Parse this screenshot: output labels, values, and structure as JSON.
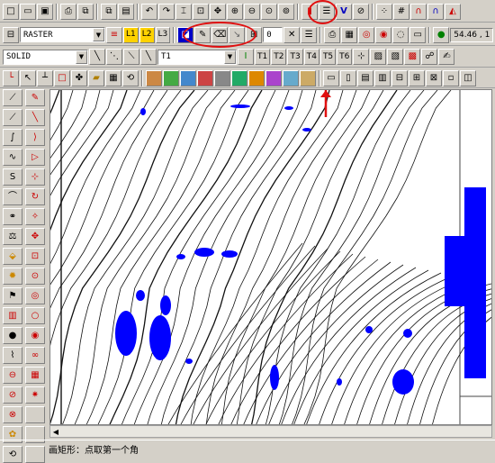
{
  "toolbar1": {
    "zoom_icons": [
      "zoom-in-icon",
      "zoom-out-icon",
      "zoom-fit-icon",
      "zoom-window-icon"
    ],
    "v_label": "V"
  },
  "toolbar2": {
    "raster_value": "RASTER",
    "layer_buttons": [
      "L1",
      "L2",
      "L3"
    ],
    "pencil_icon": "pencil-icon",
    "eraser_icon": "eraser-icon",
    "num_field": "0",
    "coordinate": "54.46 , 1"
  },
  "toolbar3": {
    "line_style": "SOLID",
    "text_style": "T1",
    "text_buttons": [
      "T1",
      "T2",
      "T3",
      "T4",
      "T5",
      "T6"
    ]
  },
  "canvas": {
    "fill_color": "#0000ff",
    "contour_color": "#111111"
  },
  "status": {
    "message": "画矩形：点取第一个角"
  }
}
